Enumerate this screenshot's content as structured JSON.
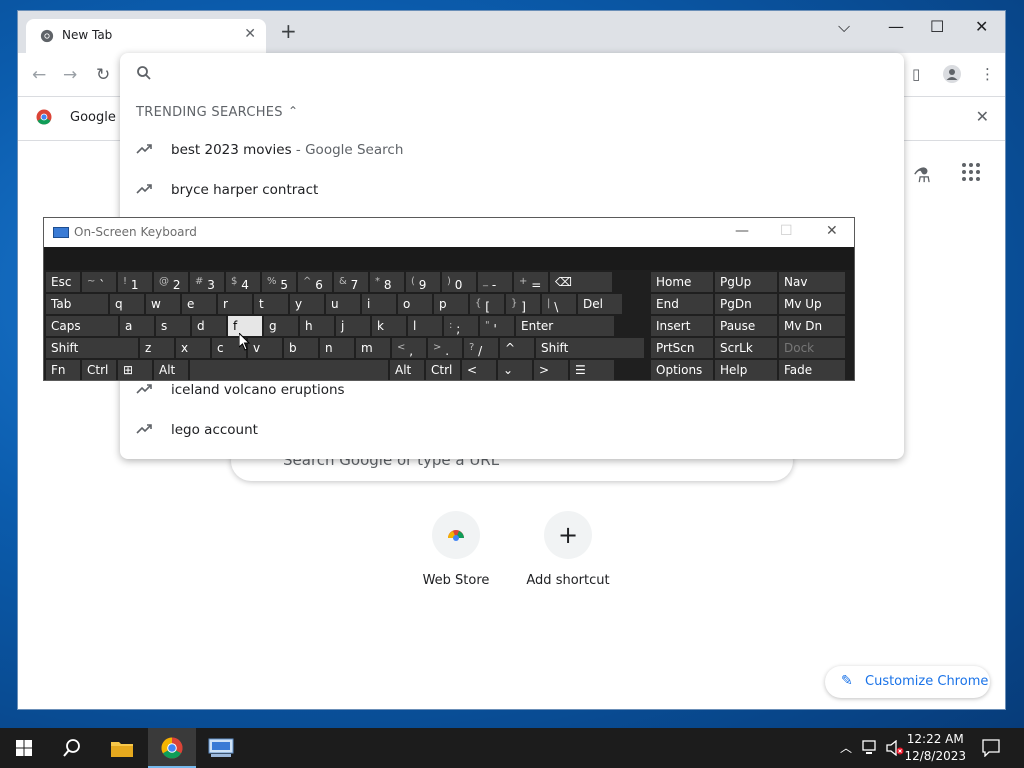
{
  "browser": {
    "tab_title": "New Tab",
    "new_tab_symbol": "+",
    "dropdown_symbol": "⌵",
    "minimize_symbol": "—",
    "maximize_symbol": "☐",
    "close_symbol": "✕"
  },
  "bookmark_bar": {
    "label": "Google C",
    "close_symbol": "✕"
  },
  "omnibox": {
    "value": "",
    "section_title": "TRENDING SEARCHES",
    "chevron": "⌃",
    "suggestions": [
      {
        "text": "best 2023 movies",
        "suffix": " - Google Search"
      },
      {
        "text": "bryce harper contract",
        "suffix": ""
      },
      {
        "text": "iceland volcano eruptions",
        "suffix": ""
      },
      {
        "text": "lego account",
        "suffix": ""
      }
    ]
  },
  "ntp": {
    "search_placeholder": "Search Google or type a URL",
    "shortcuts": [
      {
        "label": "Web Store"
      },
      {
        "label": "Add shortcut",
        "symbol": "+"
      }
    ],
    "customize_label": "Customize Chrome"
  },
  "osk": {
    "title": "On-Screen Keyboard",
    "pressed_key": "f",
    "rows": [
      [
        {
          "l": "Esc"
        },
        {
          "s": "~",
          "m": "`"
        },
        {
          "s": "!",
          "m": "1"
        },
        {
          "s": "@",
          "m": "2"
        },
        {
          "s": "#",
          "m": "3"
        },
        {
          "s": "$",
          "m": "4"
        },
        {
          "s": "%",
          "m": "5"
        },
        {
          "s": "^",
          "m": "6"
        },
        {
          "s": "&",
          "m": "7"
        },
        {
          "s": "*",
          "m": "8"
        },
        {
          "s": "(",
          "m": "9"
        },
        {
          "s": ")",
          "m": "0"
        },
        {
          "s": "_",
          "m": "-"
        },
        {
          "s": "+",
          "m": "="
        },
        {
          "l": "⌫"
        },
        {
          "l": "Home"
        },
        {
          "l": "PgUp"
        },
        {
          "l": "Nav"
        }
      ],
      [
        {
          "l": "Tab"
        },
        {
          "l": "q"
        },
        {
          "l": "w"
        },
        {
          "l": "e"
        },
        {
          "l": "r"
        },
        {
          "l": "t"
        },
        {
          "l": "y"
        },
        {
          "l": "u"
        },
        {
          "l": "i"
        },
        {
          "l": "o"
        },
        {
          "l": "p"
        },
        {
          "s": "{",
          "m": "["
        },
        {
          "s": "}",
          "m": "]"
        },
        {
          "s": "|",
          "m": "\\"
        },
        {
          "l": "Del"
        },
        {
          "l": "End"
        },
        {
          "l": "PgDn"
        },
        {
          "l": "Mv Up"
        }
      ],
      [
        {
          "l": "Caps"
        },
        {
          "l": "a"
        },
        {
          "l": "s"
        },
        {
          "l": "d"
        },
        {
          "l": "f"
        },
        {
          "l": "g"
        },
        {
          "l": "h"
        },
        {
          "l": "j"
        },
        {
          "l": "k"
        },
        {
          "l": "l"
        },
        {
          "s": ":",
          "m": ";"
        },
        {
          "s": "\"",
          "m": "'"
        },
        {
          "l": "Enter"
        },
        {
          "l": "Insert"
        },
        {
          "l": "Pause"
        },
        {
          "l": "Mv Dn"
        }
      ],
      [
        {
          "l": "Shift"
        },
        {
          "l": "z"
        },
        {
          "l": "x"
        },
        {
          "l": "c"
        },
        {
          "l": "v"
        },
        {
          "l": "b"
        },
        {
          "l": "n"
        },
        {
          "l": "m"
        },
        {
          "s": "<",
          "m": ","
        },
        {
          "s": ">",
          "m": "."
        },
        {
          "s": "?",
          "m": "/"
        },
        {
          "l": "^"
        },
        {
          "l": "Shift"
        },
        {
          "l": "PrtScn"
        },
        {
          "l": "ScrLk"
        },
        {
          "l": "Dock"
        }
      ],
      [
        {
          "l": "Fn"
        },
        {
          "l": "Ctrl"
        },
        {
          "l": "⊞"
        },
        {
          "l": "Alt"
        },
        {
          "l": " "
        },
        {
          "l": "Alt"
        },
        {
          "l": "Ctrl"
        },
        {
          "l": "<"
        },
        {
          "l": "⌄"
        },
        {
          "l": ">"
        },
        {
          "l": "☰"
        },
        {
          "l": "Options"
        },
        {
          "l": "Help"
        },
        {
          "l": "Fade"
        }
      ]
    ]
  },
  "taskbar": {
    "time": "12:22 AM",
    "date": "12/8/2023"
  }
}
